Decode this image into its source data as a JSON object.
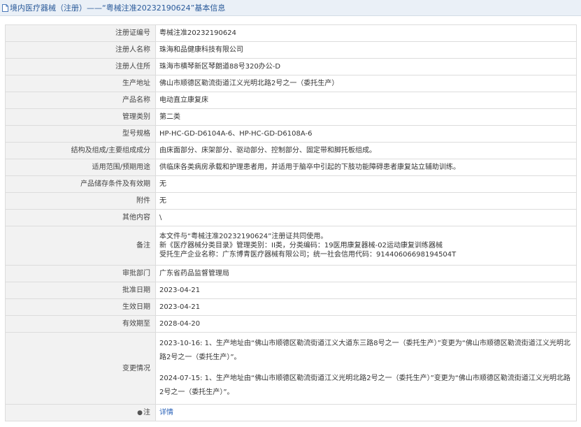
{
  "header": {
    "title": "境内医疗器械（注册）——“粤械注准20232190624”基本信息",
    "accent_color": "#2a5a9a",
    "icon": "document-icon"
  },
  "rows": [
    {
      "label": "注册证编号",
      "value": "粤械注准20232190624"
    },
    {
      "label": "注册人名称",
      "value": "珠海和品健康科技有限公司"
    },
    {
      "label": "注册人住所",
      "value": "珠海市横琴新区琴朗道88号320办公-D"
    },
    {
      "label": "生产地址",
      "value": "佛山市顺德区勒流街道江义光明北路2号之一（委托生产）"
    },
    {
      "label": "产品名称",
      "value": "电动直立康复床"
    },
    {
      "label": "管理类别",
      "value": "第二类"
    },
    {
      "label": "型号规格",
      "value": "HP-HC-GD-D6104A-6、HP-HC-GD-D6108A-6"
    },
    {
      "label": "结构及组成/主要组成成分",
      "value": "由床面部分、床架部分、驱动部分、控制部分、固定带和脚托板组成。"
    },
    {
      "label": "适用范围/预期用途",
      "value": "供临床各类病房承载和护理患者用，并适用于脑卒中引起的下肢功能障碍患者康复站立辅助训练。"
    },
    {
      "label": "产品储存条件及有效期",
      "value": "无"
    },
    {
      "label": "附件",
      "value": "无"
    },
    {
      "label": "其他内容",
      "value": "\\"
    }
  ],
  "remarks": {
    "label": "备注",
    "lines": [
      "本文件与“粤械注准20232190624”注册证共同使用。",
      "新《医疗器械分类目录》管理类别：II类，分类编码：19医用康复器械-02运动康复训练器械",
      "受托生产企业名称：广东博青医疗器械有限公司；统一社会信用代码：91440606698194504T"
    ]
  },
  "rows2": [
    {
      "label": "审批部门",
      "value": "广东省药品监督管理局"
    },
    {
      "label": "批准日期",
      "value": "2023-04-21"
    },
    {
      "label": "生效日期",
      "value": "2023-04-21"
    },
    {
      "label": "有效期至",
      "value": "2028-04-20"
    }
  ],
  "changes": {
    "label": "变更情况",
    "entries": [
      "2023-10-16: 1、生产地址由“佛山市顺德区勒流街道江义大道东三路8号之一（委托生产）”变更为“佛山市顺德区勒流街道江义光明北路2号之一（委托生产）”。",
      "2024-07-15: 1、生产地址由“佛山市顺德区勒流街道江义光明北路2号之一（委托生产）”变更为“佛山市顺德区勒流街道江义光明北路2号之一（委托生产）”。"
    ]
  },
  "footer_row": {
    "label": "注",
    "label_icon": "bullet-icon",
    "link_text": "详情",
    "link_color": "#2a62b8"
  }
}
